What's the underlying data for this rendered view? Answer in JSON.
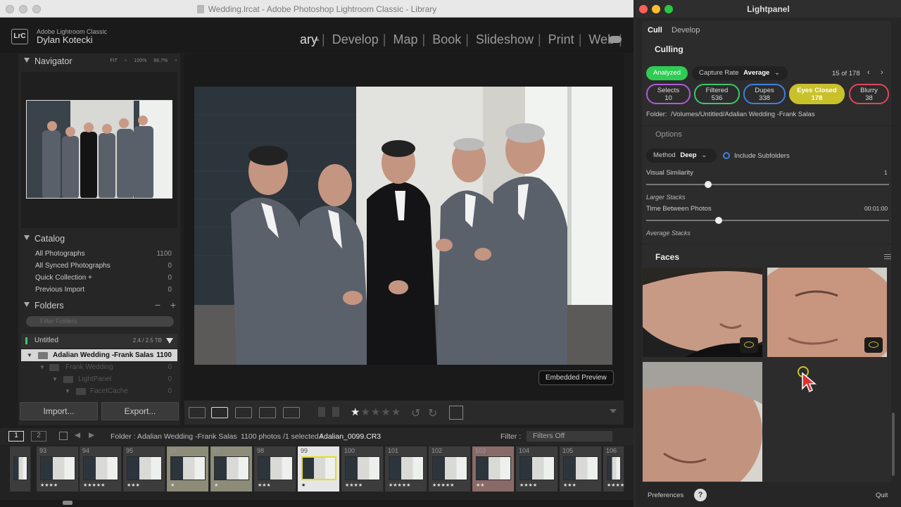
{
  "lightroom": {
    "window_title": "Wedding.lrcat - Adobe Photoshop Lightroom Classic - Library",
    "identity_small": "Adobe Lightroom Classic",
    "identity_name": "Dylan Kotecki",
    "logo": "LrC",
    "modules": [
      "ary",
      "Develop",
      "Map",
      "Book",
      "Slideshow",
      "Print",
      "Web"
    ],
    "navigator": {
      "title": "Navigator",
      "options": "FIT ÷ 100% 66.7% ÷"
    },
    "catalog": {
      "title": "Catalog",
      "items": [
        {
          "label": "All Photographs",
          "count": "1100"
        },
        {
          "label": "All Synced Photographs",
          "count": "0"
        },
        {
          "label": "Quick Collection +",
          "count": "0"
        },
        {
          "label": "Previous Import",
          "count": "0"
        }
      ]
    },
    "folders": {
      "title": "Folders",
      "search_placeholder": "Filter Folders",
      "volume": {
        "name": "Untitled",
        "size": "2.4 / 2.5 TB"
      },
      "items": [
        {
          "label": "Adalian Wedding -Frank Salas",
          "count": "1100"
        },
        {
          "label": "Frank Wedding",
          "count": "0"
        },
        {
          "label": "LightPanel",
          "count": "0"
        },
        {
          "label": "FacetCache",
          "count": "0"
        }
      ]
    },
    "import_label": "Import...",
    "export_label": "Export...",
    "embedded_preview": "Embedded Preview",
    "rating": 1,
    "filmstrip_bar": {
      "page1": "1",
      "page2": "2",
      "folder": "Folder : Adalian Wedding -Frank Salas",
      "count": "1100 photos /1 selected /",
      "filename": "Adalian_0099.CR3",
      "filter_label": "Filter :",
      "filter_value": "Filters Off"
    },
    "filmstrip": [
      {
        "n": "",
        "stars": ""
      },
      {
        "n": "93",
        "stars": "★★★★"
      },
      {
        "n": "94",
        "stars": "★★★★★"
      },
      {
        "n": "95",
        "stars": "★★★"
      },
      {
        "n": "96",
        "stars": "★"
      },
      {
        "n": "97",
        "stars": "★"
      },
      {
        "n": "98",
        "stars": "★★★"
      },
      {
        "n": "99",
        "stars": "★"
      },
      {
        "n": "100",
        "stars": "★★★★"
      },
      {
        "n": "101",
        "stars": "★★★★★"
      },
      {
        "n": "102",
        "stars": "★★★★★"
      },
      {
        "n": "103",
        "stars": "★★"
      },
      {
        "n": "104",
        "stars": "★★★★"
      },
      {
        "n": "105",
        "stars": "★★★"
      },
      {
        "n": "106",
        "stars": "★★★★"
      }
    ]
  },
  "lightpanel": {
    "title": "Lightpanel",
    "tabs": [
      "Cull",
      "Develop"
    ],
    "culling_title": "Culling",
    "analyzed": "Analyzed",
    "capture_rate_label": "Capture Rate",
    "capture_rate_value": "Average",
    "pager": "15 of 178",
    "chips": [
      {
        "label": "Selects",
        "count": "10",
        "color": "#b05ad6"
      },
      {
        "label": "Filtered",
        "count": "536",
        "color": "#3ec46d"
      },
      {
        "label": "Dupes",
        "count": "338",
        "color": "#3d7fe0"
      },
      {
        "label": "Eyes Closed",
        "count": "178",
        "color": "#c9c12a"
      },
      {
        "label": "Blurry",
        "count": "38",
        "color": "#e0455a"
      }
    ],
    "folder_label": "Folder:",
    "folder_path": "/Volumes/Untitled/Adalian Wedding -Frank Salas",
    "options_title": "Options",
    "method_label": "Method",
    "method_value": "Deep",
    "include_subfolders": "Include Subfolders",
    "visual_similarity_label": "Visual Similarity",
    "visual_similarity_value": "1",
    "larger_stacks": "Larger Stacks",
    "time_between_label": "Time Between Photos",
    "time_between_value": "00:01:00",
    "average_stacks": "Average Stacks",
    "faces_title": "Faces",
    "preferences": "Preferences",
    "help": "?",
    "quit": "Quit",
    "colors": {
      "accent_green": "#2ecc55"
    }
  }
}
